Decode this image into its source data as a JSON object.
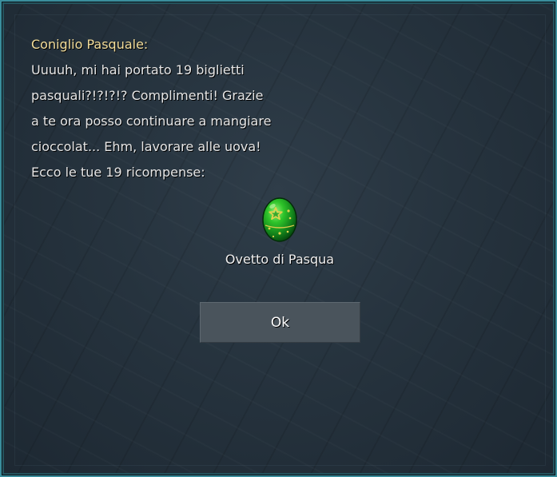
{
  "dialog": {
    "speaker": "Coniglio Pasquale:",
    "lines": [
      "Uuuuh, mi hai portato 19 biglietti",
      "pasquali?!?!?!? Complimenti! Grazie",
      "a te ora posso continuare a mangiare",
      "cioccolat... Ehm, lavorare alle uova!",
      "Ecco le tue 19 ricompense:"
    ]
  },
  "reward": {
    "icon": "green-easter-egg-icon",
    "name": "Ovetto di Pasqua"
  },
  "buttons": {
    "ok_label": "Ok"
  },
  "colors": {
    "speaker": "#f3dd9a",
    "text": "#e6e6e6",
    "frame": "#3a8e9c",
    "egg": "#1fa51f",
    "egg_pattern": "#d8c84a",
    "button": "#4a545c"
  }
}
